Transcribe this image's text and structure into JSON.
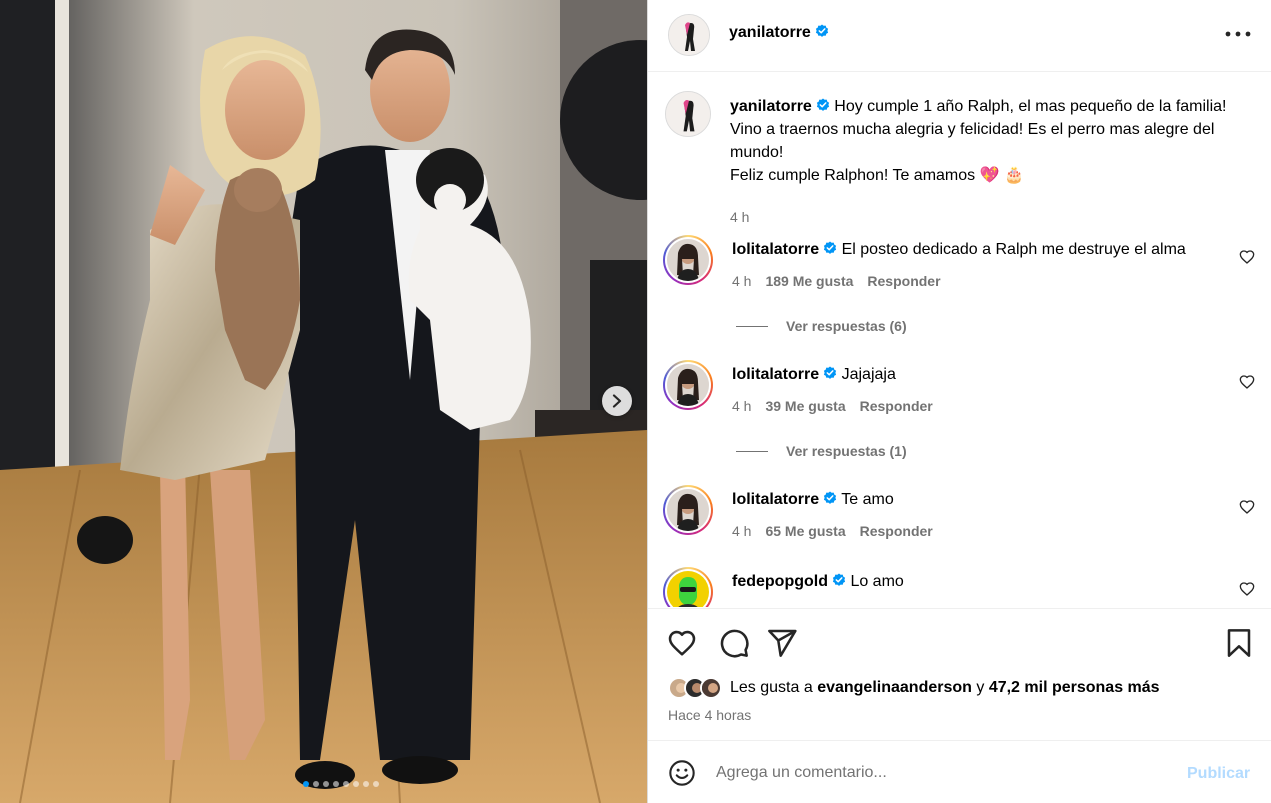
{
  "media": {
    "slide_count": 8,
    "active_slide": 1,
    "next_icon": "chevron-right-icon"
  },
  "header": {
    "username": "yanilatorre",
    "verified_icon": "verified-badge-icon",
    "more_icon": "more-horizontal-icon"
  },
  "caption": {
    "username": "yanilatorre",
    "text": "Hoy cumple 1 año Ralph, el mas pequeño de la familia! Vino a traernos mucha alegria y felicidad! Es el perro mas alegre del mundo!",
    "text2": "Feliz cumple Ralphon! Te amamos 💖 🎂",
    "time": "4 h"
  },
  "comments": [
    {
      "username": "lolitalatorre",
      "text": "El posteo dedicado a Ralph me destruye el alma",
      "time": "4 h",
      "likes": "189 Me gusta",
      "reply": "Responder",
      "view_replies": "Ver respuestas (6)"
    },
    {
      "username": "lolitalatorre",
      "text": "Jajajaja",
      "time": "4 h",
      "likes": "39 Me gusta",
      "reply": "Responder",
      "view_replies": "Ver respuestas (1)"
    },
    {
      "username": "lolitalatorre",
      "text": "Te amo",
      "time": "4 h",
      "likes": "65 Me gusta",
      "reply": "Responder"
    },
    {
      "username": "fedepopgold",
      "text": "Lo amo"
    }
  ],
  "actions": {
    "icons": [
      "heart-icon",
      "comment-icon",
      "share-icon",
      "bookmark-icon"
    ],
    "likes_prefix": "Les gusta a",
    "likes_user": "evangelinaanderson",
    "likes_conj": "y",
    "likes_count": "47,2 mil personas más",
    "posted_ago": "Hace 4 horas"
  },
  "composer": {
    "placeholder": "Agrega un comentario...",
    "publish_label": "Publicar",
    "emoji_icon": "emoji-icon"
  },
  "colors": {
    "accent": "#0095f6",
    "verified": "#0095f6",
    "publish_disabled": "#b3dbff",
    "secondary_text": "#737373",
    "divider": "#efefef"
  }
}
